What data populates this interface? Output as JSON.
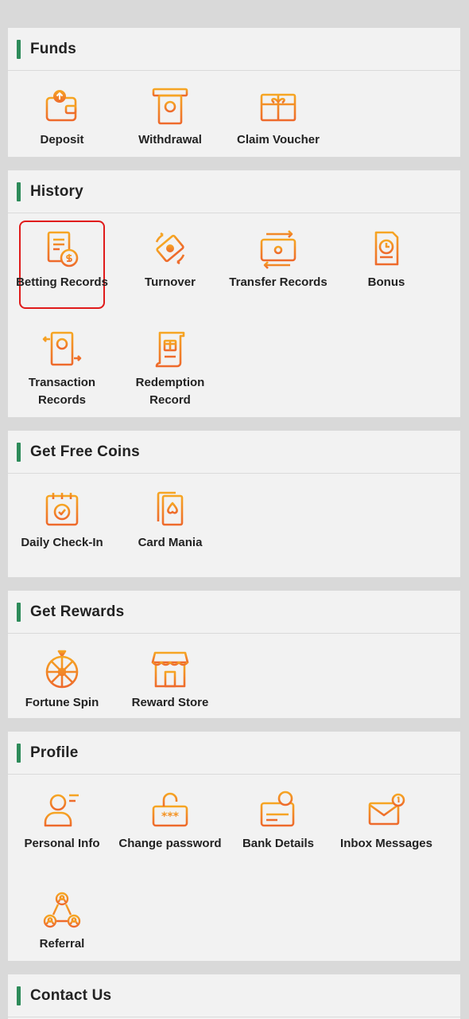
{
  "sections": [
    {
      "title": "Funds",
      "items": [
        {
          "label": "Deposit",
          "icon": "wallet-deposit-icon"
        },
        {
          "label": "Withdrawal",
          "icon": "atm-withdrawal-icon"
        },
        {
          "label": "Claim Voucher",
          "icon": "gift-voucher-icon"
        }
      ]
    },
    {
      "title": "History",
      "items": [
        {
          "label": "Betting Records",
          "icon": "document-coin-icon",
          "selected": true
        },
        {
          "label": "Turnover",
          "icon": "money-cycle-icon"
        },
        {
          "label": "Transfer Records",
          "icon": "transfer-card-icon"
        },
        {
          "label": "Bonus",
          "icon": "bonus-clock-icon"
        },
        {
          "label": "Transaction Records",
          "icon": "transaction-book-icon"
        },
        {
          "label": "Redemption Record",
          "icon": "redemption-scroll-icon"
        }
      ]
    },
    {
      "title": "Get Free Coins",
      "items": [
        {
          "label": "Daily Check-In",
          "icon": "calendar-check-icon"
        },
        {
          "label": "Card Mania",
          "icon": "spade-cards-icon"
        }
      ]
    },
    {
      "title": "Get Rewards",
      "items": [
        {
          "label": "Fortune Spin",
          "icon": "fortune-wheel-icon"
        },
        {
          "label": "Reward Store",
          "icon": "store-icon"
        }
      ]
    },
    {
      "title": "Profile",
      "items": [
        {
          "label": "Personal Info",
          "icon": "person-icon"
        },
        {
          "label": "Change password",
          "icon": "lock-password-icon"
        },
        {
          "label": "Bank Details",
          "icon": "bank-card-icon"
        },
        {
          "label": "Inbox Messages",
          "icon": "envelope-icon"
        },
        {
          "label": "Referral",
          "icon": "referral-network-icon"
        }
      ]
    },
    {
      "title": "Contact Us",
      "items": []
    }
  ],
  "colors": {
    "accent_bar": "#2e8b5a",
    "icon_orange": "#f08a24",
    "selected_border": "#e01b1b"
  }
}
